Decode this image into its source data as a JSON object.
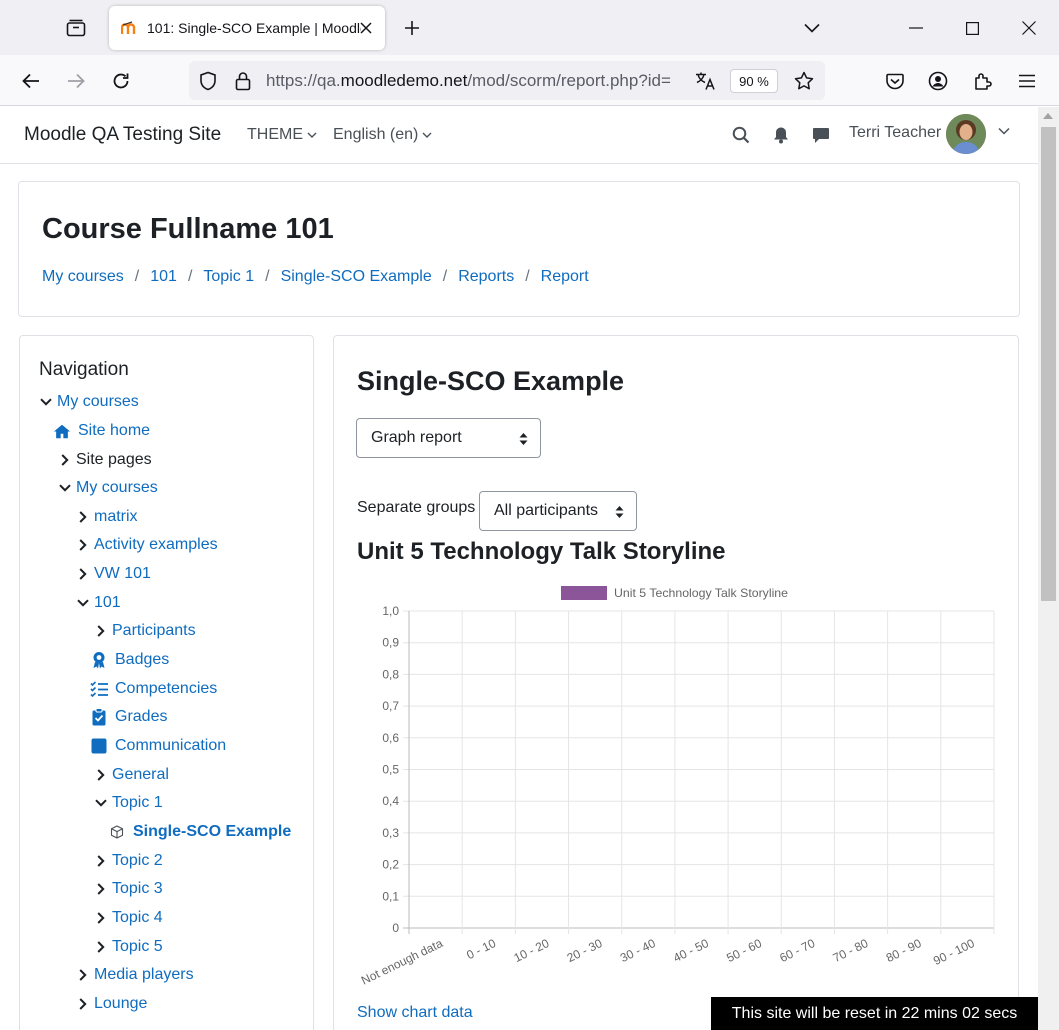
{
  "browser": {
    "tab_title": "101: Single-SCO Example | Moodle QA Testing Site",
    "url_prefix": "https://qa.",
    "url_domain": "moodledemo.net",
    "url_path": "/mod/scorm/report.php?id=",
    "zoom": "90 %"
  },
  "header": {
    "site_name": "Moodle QA Testing Site",
    "theme_label": "THEME",
    "language_label": "English (en)",
    "user_name": "Terri Teacher"
  },
  "course": {
    "title": "Course Fullname 101",
    "breadcrumb": [
      "My courses",
      "101",
      "Topic 1",
      "Single-SCO Example",
      "Reports",
      "Report"
    ]
  },
  "navigation": {
    "title": "Navigation",
    "items": [
      {
        "label": "My courses",
        "chevron": "down",
        "icon": ""
      },
      {
        "label": "Site home",
        "chevron": "",
        "icon": "home-icon"
      },
      {
        "label": "Site pages",
        "chevron": "right",
        "icon": ""
      },
      {
        "label": "My courses",
        "chevron": "down",
        "icon": ""
      },
      {
        "label": "matrix",
        "chevron": "right",
        "icon": ""
      },
      {
        "label": "Activity examples",
        "chevron": "right",
        "icon": ""
      },
      {
        "label": "VW 101",
        "chevron": "right",
        "icon": ""
      },
      {
        "label": "101",
        "chevron": "down",
        "icon": ""
      },
      {
        "label": "Participants",
        "chevron": "right",
        "icon": ""
      },
      {
        "label": "Badges",
        "chevron": "",
        "icon": "badge-icon"
      },
      {
        "label": "Competencies",
        "chevron": "",
        "icon": "checklist-icon"
      },
      {
        "label": "Grades",
        "chevron": "",
        "icon": "clipboard-check-icon"
      },
      {
        "label": "Communication",
        "chevron": "",
        "icon": "square-icon"
      },
      {
        "label": "General",
        "chevron": "right",
        "icon": ""
      },
      {
        "label": "Topic 1",
        "chevron": "down",
        "icon": ""
      },
      {
        "label": "Single-SCO Example",
        "chevron": "",
        "icon": "package-icon"
      },
      {
        "label": "Topic 2",
        "chevron": "right",
        "icon": ""
      },
      {
        "label": "Topic 3",
        "chevron": "right",
        "icon": ""
      },
      {
        "label": "Topic 4",
        "chevron": "right",
        "icon": ""
      },
      {
        "label": "Topic 5",
        "chevron": "right",
        "icon": ""
      },
      {
        "label": "Media players",
        "chevron": "right",
        "icon": ""
      },
      {
        "label": "Lounge",
        "chevron": "right",
        "icon": ""
      }
    ]
  },
  "main": {
    "title": "Single-SCO Example",
    "report_select": "Graph report",
    "groups_label": "Separate groups",
    "groups_select": "All participants",
    "chart_heading": "Unit 5 Technology Talk Storyline",
    "show_chart_data": "Show chart data"
  },
  "chart_data": {
    "type": "bar",
    "categories": [
      "Not enough data",
      "0 - 10",
      "10 - 20",
      "20 - 30",
      "30 - 40",
      "40 - 50",
      "50 - 60",
      "60 - 70",
      "70 - 80",
      "80 - 90",
      "90 - 100"
    ],
    "series": [
      {
        "name": "Unit 5 Technology Talk Storyline",
        "color": "#8c559a",
        "values": [
          0,
          0,
          0,
          0,
          0,
          0,
          0,
          0,
          0,
          0,
          0
        ]
      }
    ],
    "yticks": [
      "0",
      "0,1",
      "0,2",
      "0,3",
      "0,4",
      "0,5",
      "0,6",
      "0,7",
      "0,8",
      "0,9",
      "1,0"
    ],
    "ylim": [
      0,
      1
    ],
    "grid": true,
    "legend": "top"
  },
  "banner": {
    "text": "This site will be reset in 22 mins 02 secs"
  },
  "colors": {
    "link": "#0f6cbf",
    "series": "#8c559a",
    "banner_bg": "#000000"
  }
}
